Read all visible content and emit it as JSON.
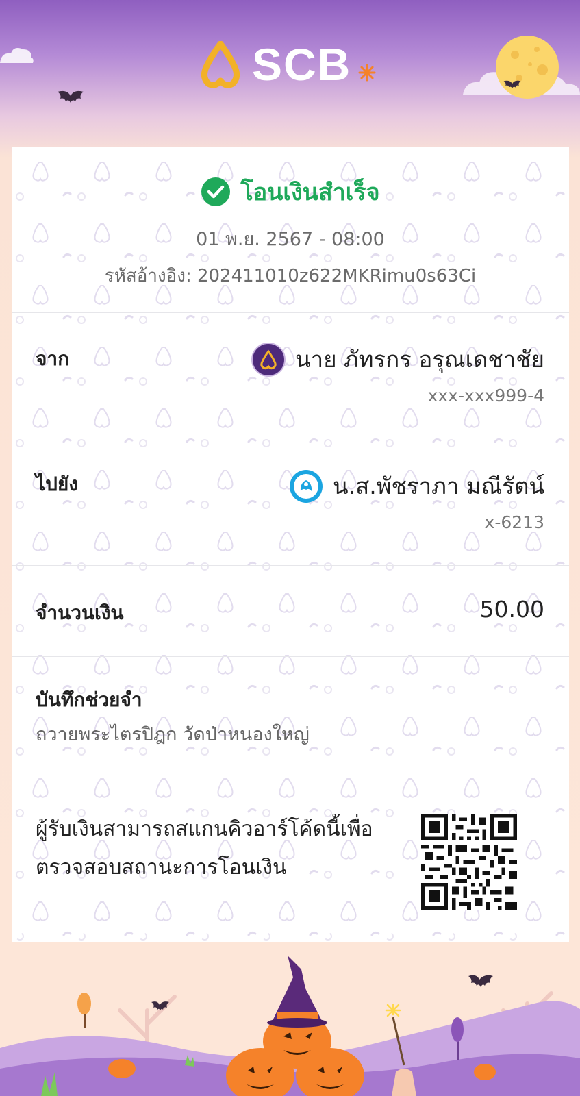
{
  "header": {
    "brand": "SCB"
  },
  "receipt": {
    "status": "โอนเงินสำเร็จ",
    "datetime": "01 พ.ย. 2567 - 08:00",
    "reference_label": "รหัสอ้างอิง:",
    "reference_value": "202411010z622MKRimu0s63Ci",
    "from": {
      "label": "จาก",
      "name": "นาย ภัทรกร อรุณเดชาชัย",
      "account": "xxx-xxx999-4",
      "bank_icon": "scb-bank-icon"
    },
    "to": {
      "label": "ไปยัง",
      "name": "น.ส.พัชราภา มณีรัตน์",
      "account": "x-6213",
      "bank_icon": "krungthai-bank-icon"
    },
    "amount": {
      "label": "จำนวนเงิน",
      "value": "50.00"
    },
    "memo": {
      "label": "บันทึกช่วยจำ",
      "text": "ถวายพระไตรปิฎก วัดป่าหนองใหญ่"
    },
    "qr": {
      "line1": "ผู้รับเงินสามารถสแกนคิวอาร์โค้ดนี้เพื่อ",
      "line2": "ตรวจสอบสถานะการโอนเงิน"
    }
  },
  "colors": {
    "header_purple": "#8f5fc0",
    "success_green": "#1fa95a",
    "scb_gold": "#f2b128",
    "scb_purple": "#4d2a7a",
    "ktb_blue": "#1ba5e1",
    "pumpkin_orange": "#f5822a"
  }
}
